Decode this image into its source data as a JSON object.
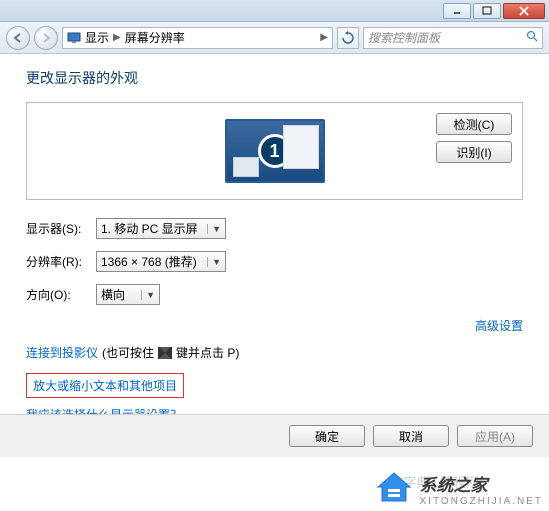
{
  "titlebar": {
    "min": "_",
    "max": "□",
    "close": "×"
  },
  "address": {
    "root": "显示",
    "current": "屏幕分辨率",
    "search_placeholder": "搜索控制面板"
  },
  "heading": "更改显示器的外观",
  "preview": {
    "monitor_number": "1",
    "detect": "检测(C)",
    "identify": "识别(I)"
  },
  "form": {
    "display_label": "显示器(S):",
    "display_value": "1. 移动 PC 显示屏",
    "resolution_label": "分辨率(R):",
    "resolution_value": "1366 × 768 (推荐)",
    "orientation_label": "方向(O):",
    "orientation_value": "横向"
  },
  "advanced": "高级设置",
  "projector": {
    "link": "连接到投影仪",
    "hint_before": "(也可按住",
    "hint_after": "键并点击 P)"
  },
  "zoom_link": "放大或缩小文本和其他项目",
  "which_display": "我应该选择什么显示器设置？",
  "buttons": {
    "ok": "确定",
    "cancel": "取消",
    "apply": "应用(A)"
  },
  "watermark": {
    "title": "系统之家",
    "sub": "XITONGZHIJIA.NET",
    "faint": "查字典 | 教程网"
  }
}
